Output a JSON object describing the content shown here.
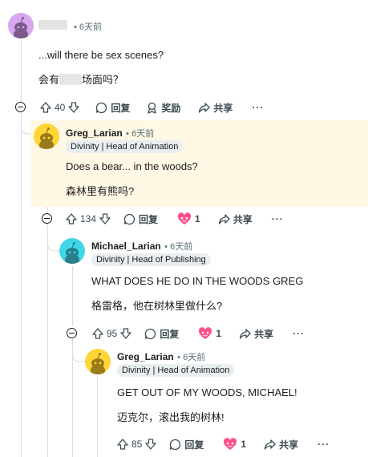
{
  "op_comment": {
    "author_blurred": true,
    "time": "6天前",
    "lines": [
      "...will there be sex scenes?",
      "会有",
      "场面吗？"
    ],
    "votes": "40",
    "reply_label": "回复",
    "award_label": "奖励",
    "share_label": "共享",
    "more_label": "···"
  },
  "reply1": {
    "author": "Greg_Larian",
    "time": "6天前",
    "flair": "Divinity | Head of Animation",
    "lines": [
      "Does a bear... in the woods?",
      "森林里有熊吗?"
    ],
    "votes": "134",
    "reply_label": "回复",
    "reaction_count": "1",
    "share_label": "共享",
    "more_label": "···"
  },
  "reply2": {
    "author": "Michael_Larian",
    "time": "6天前",
    "flair": "Divinity | Head of Publishing",
    "lines": [
      "WHAT DOES HE DO IN THE WOODS GREG",
      "格雷格，他在树林里做什么?"
    ],
    "votes": "95",
    "reply_label": "回复",
    "reaction_count": "1",
    "share_label": "共享",
    "more_label": "···"
  },
  "reply3": {
    "author": "Greg_Larian",
    "time": "6天前",
    "flair": "Divinity | Head of Animation",
    "lines": [
      "GET OUT OF MY WOODS, MICHAEL!",
      "迈克尔，滚出我的树林!"
    ],
    "votes": "85",
    "reply_label": "回复",
    "reaction_count": "1",
    "share_label": "共享",
    "more_label": "···"
  },
  "colors": {
    "highlight": "#fff8e5",
    "avatar_purple": "#d9a6f0",
    "avatar_yellow": "#ffd635",
    "avatar_cyan": "#3fd7e8",
    "reaction_pink": "#ff4f8b"
  }
}
